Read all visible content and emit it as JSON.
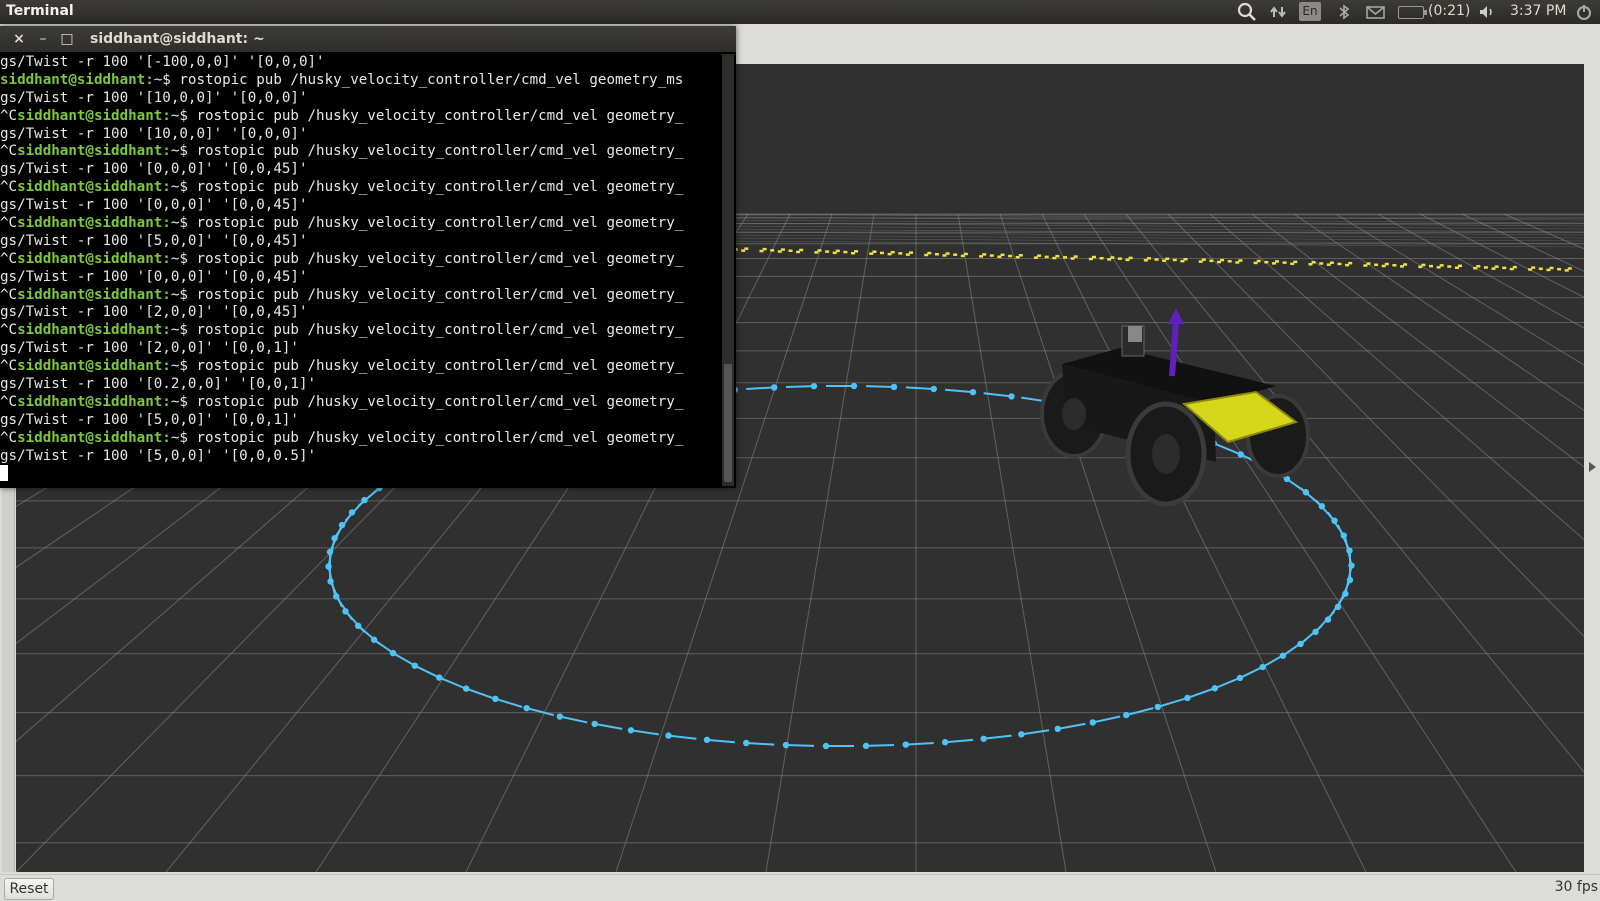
{
  "top_panel": {
    "app_title": "Terminal",
    "language": "En",
    "battery_time": "(0:21)",
    "clock": "3:37 PM",
    "icons": [
      "search-icon",
      "network-icon",
      "bluetooth-icon",
      "mail-icon",
      "battery-icon",
      "volume-icon",
      "power-icon"
    ]
  },
  "terminal": {
    "title": "siddhant@siddhant: ~",
    "controls": {
      "close": "×",
      "minimize": "–",
      "maximize": "□"
    },
    "lines": [
      {
        "prefix": "",
        "prompt": "",
        "text": "gs/Twist -r 100 '[-100,0,0]' '[0,0,0]'"
      },
      {
        "prefix": "",
        "prompt": "siddhant@siddhant:",
        "text": "~$ rostopic pub /husky_velocity_controller/cmd_vel geometry_ms"
      },
      {
        "prefix": "",
        "prompt": "",
        "text": "gs/Twist -r 100 '[10,0,0]' '[0,0,0]'"
      },
      {
        "prefix": "^C",
        "prompt": "siddhant@siddhant:",
        "text": "~$ rostopic pub /husky_velocity_controller/cmd_vel geometry_"
      },
      {
        "prefix": "",
        "prompt": "",
        "text": "gs/Twist -r 100 '[10,0,0]' '[0,0,0]'"
      },
      {
        "prefix": "^C",
        "prompt": "siddhant@siddhant:",
        "text": "~$ rostopic pub /husky_velocity_controller/cmd_vel geometry_"
      },
      {
        "prefix": "",
        "prompt": "",
        "text": "gs/Twist -r 100 '[0,0,0]' '[0,0,45]'"
      },
      {
        "prefix": "^C",
        "prompt": "siddhant@siddhant:",
        "text": "~$ rostopic pub /husky_velocity_controller/cmd_vel geometry_"
      },
      {
        "prefix": "",
        "prompt": "",
        "text": "gs/Twist -r 100 '[0,0,0]' '[0,0,45]'"
      },
      {
        "prefix": "^C",
        "prompt": "siddhant@siddhant:",
        "text": "~$ rostopic pub /husky_velocity_controller/cmd_vel geometry_"
      },
      {
        "prefix": "",
        "prompt": "",
        "text": "gs/Twist -r 100 '[5,0,0]' '[0,0,45]'"
      },
      {
        "prefix": "^C",
        "prompt": "siddhant@siddhant:",
        "text": "~$ rostopic pub /husky_velocity_controller/cmd_vel geometry_"
      },
      {
        "prefix": "",
        "prompt": "",
        "text": "gs/Twist -r 100 '[0,0,0]' '[0,0,45]'"
      },
      {
        "prefix": "^C",
        "prompt": "siddhant@siddhant:",
        "text": "~$ rostopic pub /husky_velocity_controller/cmd_vel geometry_"
      },
      {
        "prefix": "",
        "prompt": "",
        "text": "gs/Twist -r 100 '[2,0,0]' '[0,0,45]'"
      },
      {
        "prefix": "^C",
        "prompt": "siddhant@siddhant:",
        "text": "~$ rostopic pub /husky_velocity_controller/cmd_vel geometry_"
      },
      {
        "prefix": "",
        "prompt": "",
        "text": "gs/Twist -r 100 '[2,0,0]' '[0,0,1]'"
      },
      {
        "prefix": "^C",
        "prompt": "siddhant@siddhant:",
        "text": "~$ rostopic pub /husky_velocity_controller/cmd_vel geometry_"
      },
      {
        "prefix": "",
        "prompt": "",
        "text": "gs/Twist -r 100 '[0.2,0,0]' '[0,0,1]'"
      },
      {
        "prefix": "^C",
        "prompt": "siddhant@siddhant:",
        "text": "~$ rostopic pub /husky_velocity_controller/cmd_vel geometry_"
      },
      {
        "prefix": "",
        "prompt": "",
        "text": "gs/Twist -r 100 '[5,0,0]' '[0,0,1]'"
      },
      {
        "prefix": "^C",
        "prompt": "siddhant@siddhant:",
        "text": "~$ rostopic pub /husky_velocity_controller/cmd_vel geometry_"
      },
      {
        "prefix": "",
        "prompt": "",
        "text": "gs/Twist -r 100 '[5,0,0]' '[0,0,0.5]'"
      }
    ]
  },
  "rviz": {
    "reset_label": "Reset",
    "fps": "30 fps"
  },
  "colors": {
    "grid": "#8a8a8a",
    "path": "#4fc3f7",
    "laser": "#f0e040",
    "robot_plate": "#d6d61a",
    "axis": "#6020c0"
  }
}
